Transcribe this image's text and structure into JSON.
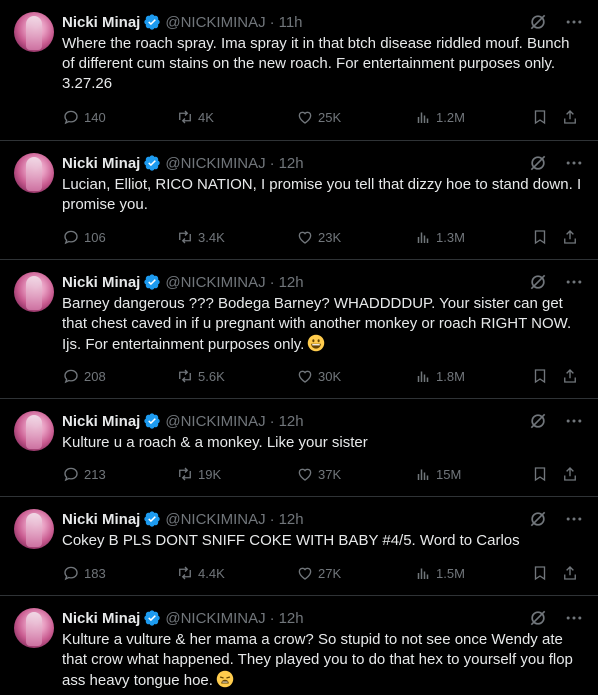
{
  "author": {
    "name": "Nicki Minaj",
    "handle": "@NICKIMINAJ"
  },
  "icons": {
    "verified": "verified-badge-icon",
    "grok": "grok-icon",
    "more": "more-icon",
    "reply": "reply-icon",
    "retweet": "retweet-icon",
    "like": "like-icon",
    "views": "views-icon",
    "bookmark": "bookmark-icon",
    "share": "share-icon"
  },
  "colors": {
    "background": "#000000",
    "text": "#e7e9ea",
    "muted": "#71767b",
    "verified": "#1d9bf0",
    "divider": "#2f3336"
  },
  "tweets": [
    {
      "time": "11h",
      "text": "Where the roach spray. Ima spray it in that btch disease riddled mouf. Bunch of different cum stains on the new roach. For entertainment purposes only. 3.27.26",
      "replies": "140",
      "retweets": "4K",
      "likes": "25K",
      "views": "1.2M"
    },
    {
      "time": "12h",
      "text": "Lucian, Elliot, RICO NATION, I promise you tell that dizzy hoe to stand down. I promise you.",
      "replies": "106",
      "retweets": "3.4K",
      "likes": "23K",
      "views": "1.3M"
    },
    {
      "time": "12h",
      "text": "Barney dangerous ??? Bodega Barney? WHADDDDUP. Your sister can get that chest caved in if u pregnant with another monkey or roach RIGHT NOW. Ijs. For entertainment purposes only.",
      "emoji": "grinning-face-emoji",
      "replies": "208",
      "retweets": "5.6K",
      "likes": "30K",
      "views": "1.8M"
    },
    {
      "time": "12h",
      "text": "Kulture u a roach & a monkey. Like your sister",
      "replies": "213",
      "retweets": "19K",
      "likes": "37K",
      "views": "15M"
    },
    {
      "time": "12h",
      "text": "Cokey B PLS DONT SNIFF COKE WITH BABY #4/5. Word to Carlos",
      "replies": "183",
      "retweets": "4.4K",
      "likes": "27K",
      "views": "1.5M"
    },
    {
      "time": "12h",
      "text": "Kulture a vulture & her mama a crow? So stupid to not see once Wendy ate that crow what happened. They played you to do that hex to yourself you flop ass heavy tongue hoe.",
      "emoji": "weary-face-emoji"
    }
  ]
}
